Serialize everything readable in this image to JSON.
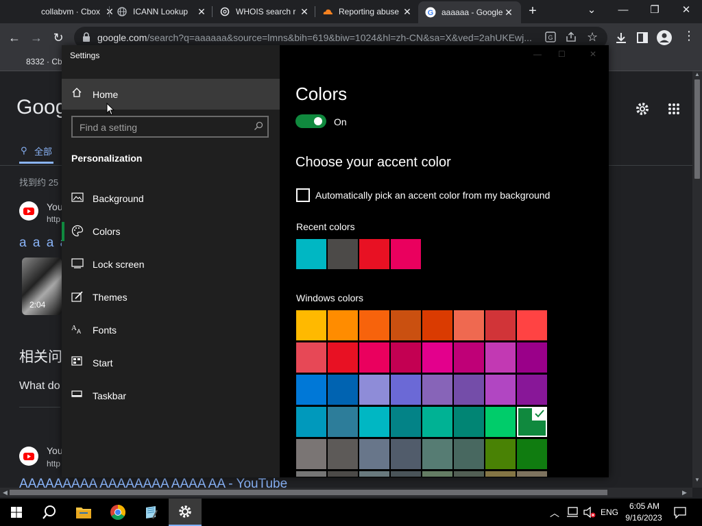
{
  "browser": {
    "tabs": [
      {
        "title": "collabvm · Cbox",
        "active": false
      },
      {
        "title": "ICANN Lookup",
        "active": false
      },
      {
        "title": "WHOIS search r",
        "active": false
      },
      {
        "title": "Reporting abuse",
        "active": false
      },
      {
        "title": "aaaaaa - Google",
        "active": true
      }
    ],
    "url_host": "google.com",
    "url_path": "/search?q=aaaaaa&source=lmns&bih=619&biw=1024&hl=zh-CN&sa=X&ved=2ahUKEwj...",
    "bookmark": "8332 · Cb"
  },
  "google": {
    "logo": "Goog",
    "tab_all": "全部",
    "result_count": "找到约 25",
    "result1_title": "You",
    "result1_url": "http",
    "result_heading": "a a a a",
    "video_duration": "2:04",
    "related_heading": "相关问",
    "related_q": "What do",
    "result2_title": "You",
    "result2_url": "http",
    "bottom_link": "AAAAAAAAA AAAAAAAA AAAA AA - YouTube"
  },
  "settings": {
    "window_title": "Settings",
    "home": "Home",
    "search_placeholder": "Find a setting",
    "section": "Personalization",
    "nav": [
      {
        "label": "Background",
        "icon": "image-icon"
      },
      {
        "label": "Colors",
        "icon": "palette-icon"
      },
      {
        "label": "Lock screen",
        "icon": "lock-screen-icon"
      },
      {
        "label": "Themes",
        "icon": "themes-icon"
      },
      {
        "label": "Fonts",
        "icon": "fonts-icon"
      },
      {
        "label": "Start",
        "icon": "start-icon"
      },
      {
        "label": "Taskbar",
        "icon": "taskbar-icon"
      }
    ],
    "page_title": "Colors",
    "toggle_label": "On",
    "toggle_on": true,
    "accent_heading": "Choose your accent color",
    "auto_pick_label": "Automatically pick an accent color from my background",
    "auto_pick_checked": false,
    "recent_label": "Recent colors",
    "recent_colors": [
      "#00b7c3",
      "#4c4a48",
      "#e81123",
      "#ea005e"
    ],
    "windows_label": "Windows colors",
    "windows_colors": [
      [
        "#ffb900",
        "#ff8c00",
        "#f7630c",
        "#ca5010",
        "#da3b01",
        "#ef6950",
        "#d13438",
        "#ff4343"
      ],
      [
        "#e74856",
        "#e81123",
        "#ea005e",
        "#c30052",
        "#e3008c",
        "#bf0077",
        "#c239b3",
        "#9a0089"
      ],
      [
        "#0078d7",
        "#0063b1",
        "#8e8cd8",
        "#6b69d6",
        "#8764b8",
        "#744da9",
        "#b146c2",
        "#881798"
      ],
      [
        "#0099bc",
        "#2d7d9a",
        "#00b7c3",
        "#038387",
        "#00b294",
        "#018574",
        "#00cc6a",
        "#10893e"
      ],
      [
        "#7a7574",
        "#5d5a58",
        "#68768a",
        "#515c6b",
        "#567c73",
        "#486860",
        "#498205",
        "#107c10"
      ],
      [
        "#767676",
        "#4c4a48",
        "#69797e",
        "#4a5459",
        "#647c64",
        "#525e54",
        "#847545",
        "#7e735f"
      ]
    ],
    "selected_color": "#10893e"
  },
  "taskbar": {
    "time": "6:05 AM",
    "date": "9/16/2023",
    "lang": "ENG"
  }
}
